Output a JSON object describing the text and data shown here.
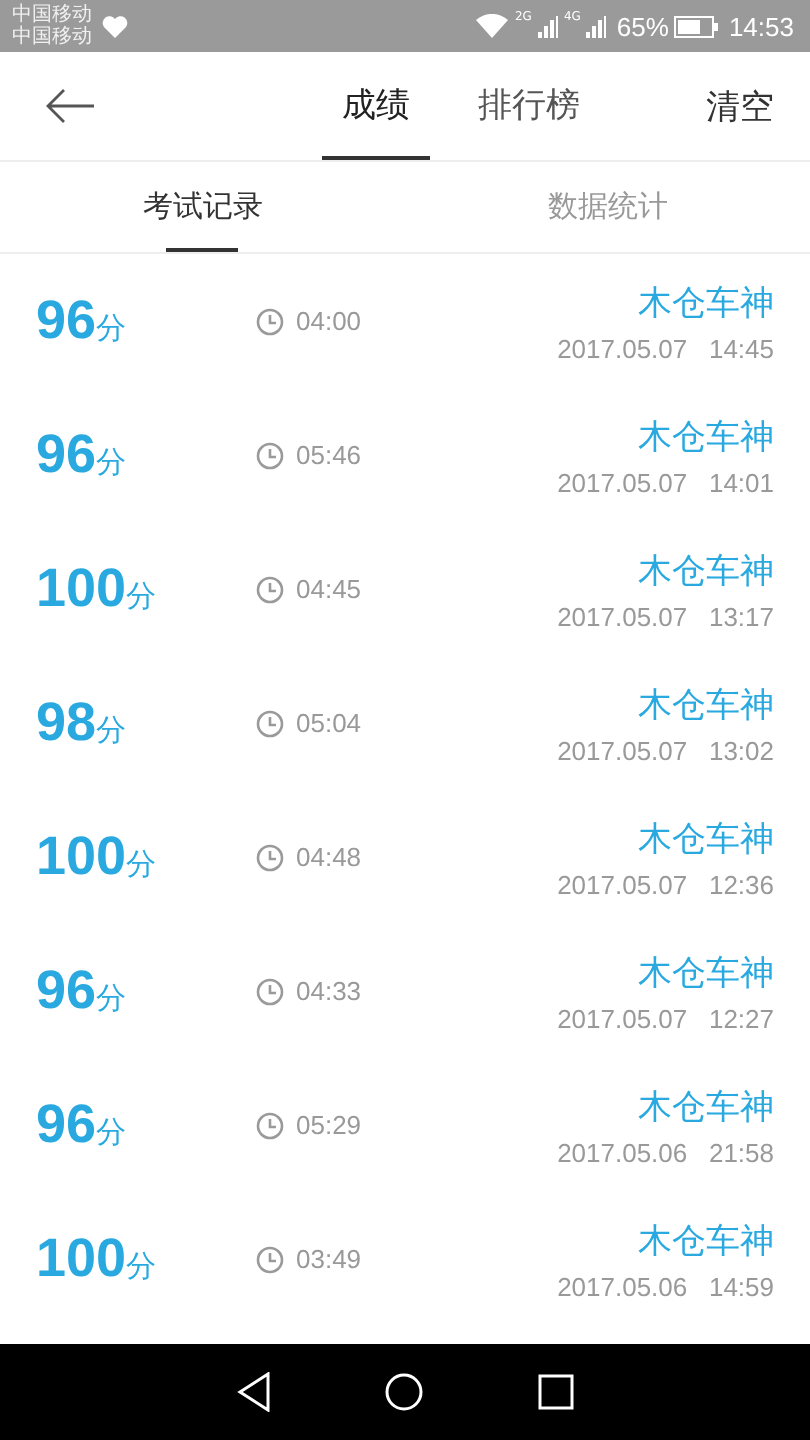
{
  "status_bar": {
    "carriers": [
      "中国移动",
      "中国移动"
    ],
    "network_labels": [
      "2G",
      "4G"
    ],
    "battery": "65%",
    "time": "14:53"
  },
  "header": {
    "tabs": [
      {
        "label": "成绩",
        "selected": true
      },
      {
        "label": "排行榜",
        "selected": false
      }
    ],
    "action": "清空"
  },
  "sub_tabs": [
    {
      "label": "考试记录",
      "selected": true
    },
    {
      "label": "数据统计",
      "selected": false
    }
  ],
  "records": [
    {
      "score": "96",
      "unit": "分",
      "duration": "04:00",
      "name": "木仓车神",
      "date": "2017.05.07",
      "time": "14:45"
    },
    {
      "score": "96",
      "unit": "分",
      "duration": "05:46",
      "name": "木仓车神",
      "date": "2017.05.07",
      "time": "14:01"
    },
    {
      "score": "100",
      "unit": "分",
      "duration": "04:45",
      "name": "木仓车神",
      "date": "2017.05.07",
      "time": "13:17"
    },
    {
      "score": "98",
      "unit": "分",
      "duration": "05:04",
      "name": "木仓车神",
      "date": "2017.05.07",
      "time": "13:02"
    },
    {
      "score": "100",
      "unit": "分",
      "duration": "04:48",
      "name": "木仓车神",
      "date": "2017.05.07",
      "time": "12:36"
    },
    {
      "score": "96",
      "unit": "分",
      "duration": "04:33",
      "name": "木仓车神",
      "date": "2017.05.07",
      "time": "12:27"
    },
    {
      "score": "96",
      "unit": "分",
      "duration": "05:29",
      "name": "木仓车神",
      "date": "2017.05.06",
      "time": "21:58"
    },
    {
      "score": "100",
      "unit": "分",
      "duration": "03:49",
      "name": "木仓车神",
      "date": "2017.05.06",
      "time": "14:59"
    }
  ]
}
